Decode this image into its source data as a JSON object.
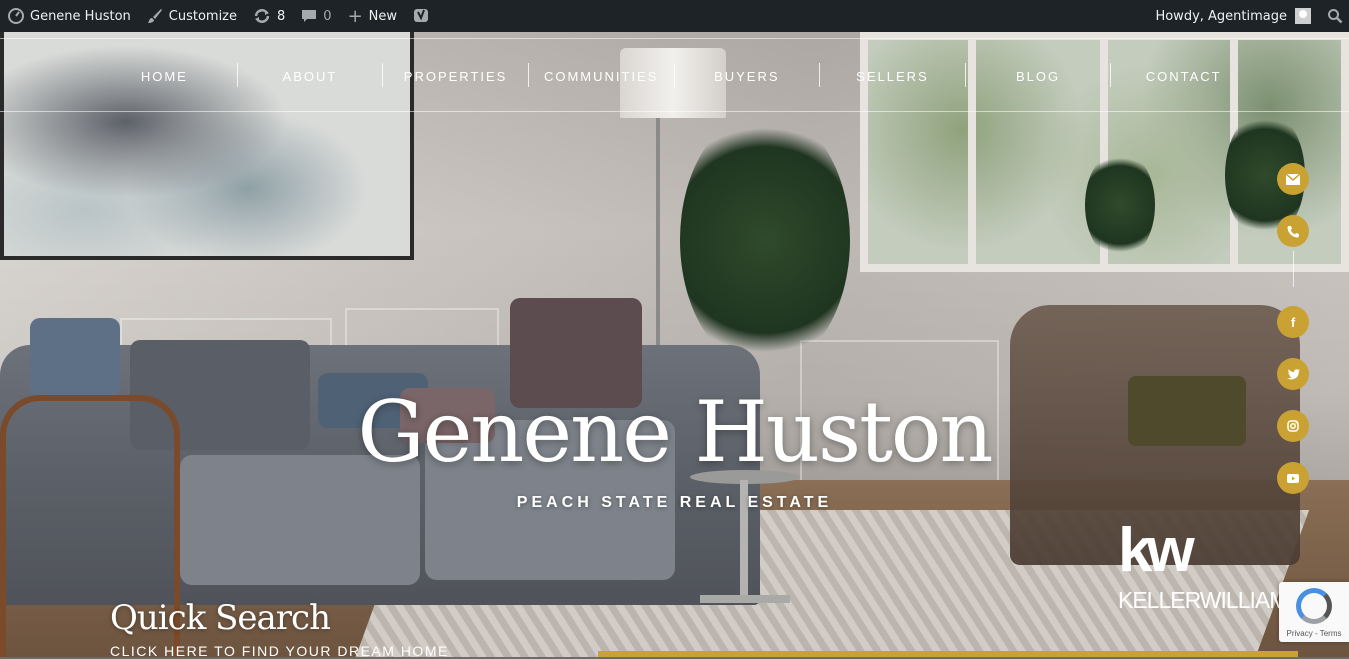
{
  "admin_bar": {
    "site_name": "Genene Huston",
    "customize": "Customize",
    "updates_count": "8",
    "comments_count": "0",
    "new_label": "New",
    "howdy": "Howdy, Agentimage"
  },
  "nav": {
    "items": [
      "HOME",
      "ABOUT",
      "PROPERTIES",
      "COMMUNITIES",
      "BUYERS",
      "SELLERS",
      "BLOG",
      "CONTACT"
    ]
  },
  "hero": {
    "title": "Genene Huston",
    "subtitle": "PEACH STATE REAL ESTATE"
  },
  "logo": {
    "mark": "kw",
    "text": "KELLERWILLIAMS"
  },
  "quick_search": {
    "title": "Quick Search",
    "link": "CLICK HERE TO FIND YOUR DREAM HOME"
  },
  "recaptcha": {
    "text": "Privacy - Terms"
  },
  "social": {
    "icons": [
      "envelope-icon",
      "phone-icon",
      "facebook-icon",
      "twitter-icon",
      "instagram-icon",
      "youtube-icon"
    ]
  },
  "colors": {
    "admin_bar": "#1d2327",
    "accent_gold": "#c9a233"
  }
}
